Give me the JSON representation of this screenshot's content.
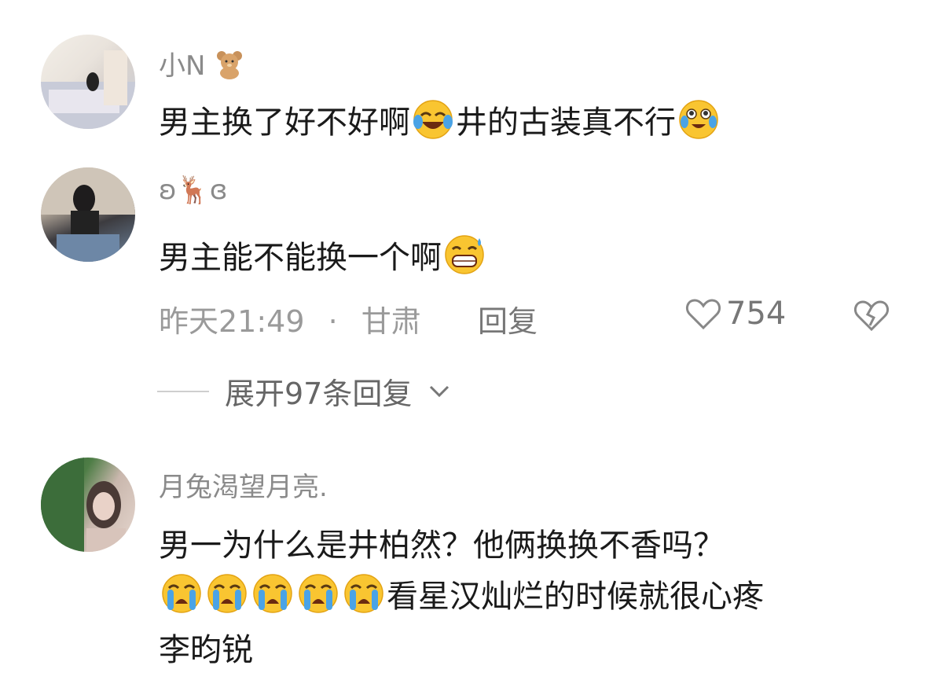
{
  "comments": [
    {
      "username": "小N",
      "username_emoji": "teddy-bear-icon",
      "text_a": "男主换了好不好啊",
      "emoji_a": "laughing-tears-icon",
      "text_b": "井的古装真不行",
      "emoji_b": "crying-laughing-icon"
    },
    {
      "username": "ʚ🦌ɞ",
      "text": "男主能不能换一个啊",
      "emoji": "grinning-sweat-icon",
      "time": "昨天21:49",
      "separator": "·",
      "location": "甘肃",
      "reply_label": "回复",
      "likes": "754",
      "expand_label": "展开97条回复"
    },
    {
      "username": "月兔渴望月亮.",
      "line1": "男一为什么是井柏然？他俩换换不香吗？",
      "line2_emojis": [
        "loudly-crying-icon",
        "loudly-crying-icon",
        "loudly-crying-icon",
        "loudly-crying-icon",
        "loudly-crying-icon"
      ],
      "line2_text": "看星汉灿烂的时候就很心疼",
      "line3": "李昀锐"
    }
  ]
}
